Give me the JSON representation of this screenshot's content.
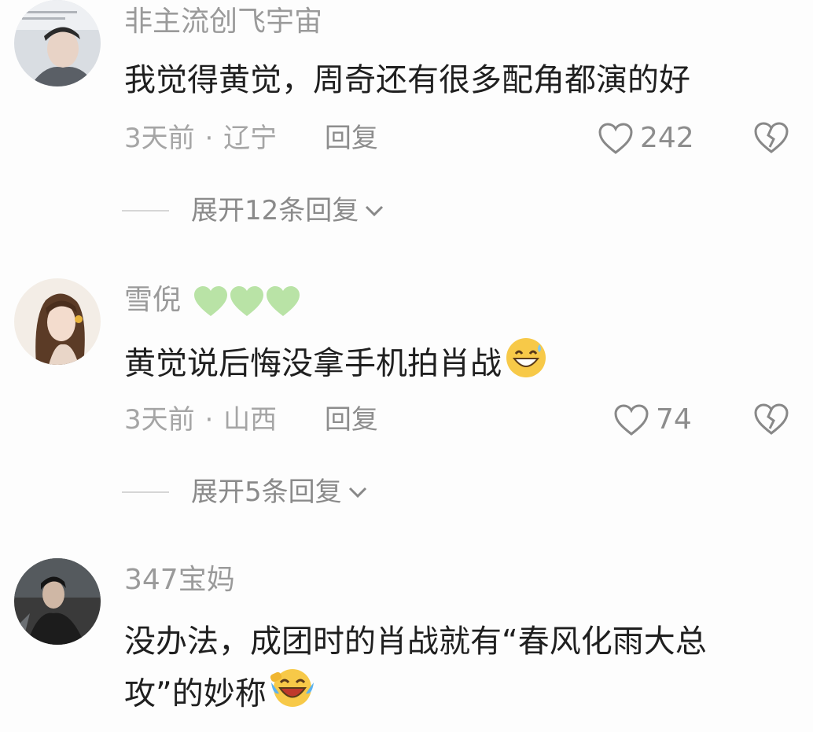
{
  "comments": [
    {
      "username": "非主流创飞宇宙",
      "text": "我觉得黄觉，周奇还有很多配角都演的好",
      "time": "3天前",
      "location": "辽宁",
      "reply_label": "回复",
      "likes": "242",
      "expand_label": "展开12条回复"
    },
    {
      "username": "雪倪",
      "username_hearts": [
        "green-heart-icon",
        "green-heart-icon",
        "green-heart-icon"
      ],
      "text": "黄觉说后悔没拿手机拍肖战",
      "text_emoji": "grinning-sweat-emoji",
      "time": "3天前",
      "location": "山西",
      "reply_label": "回复",
      "likes": "74",
      "expand_label": "展开5条回复"
    },
    {
      "username": "347宝妈",
      "text_line1": "没办法，成团时的肖战就有“春风化雨大总",
      "text_line2": "攻”的妙称",
      "text_emoji": "laughing-crying-emoji"
    }
  ],
  "meta_separator": "·",
  "colors": {
    "background": "#fdfdfd",
    "username": "#9a9a9a",
    "body_text": "#1f1f1f",
    "meta": "#a5a5a5",
    "heart_green": "#b9e3a6"
  }
}
